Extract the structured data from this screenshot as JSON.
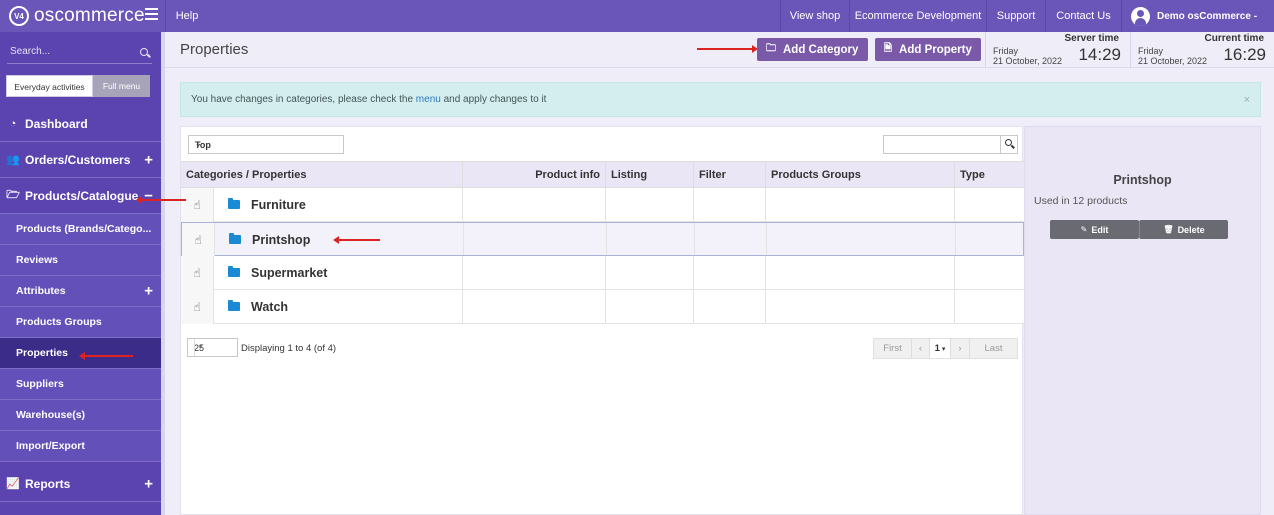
{
  "app": {
    "logo_text": "oscommerce",
    "logo_mark": "V4"
  },
  "topbar": {
    "help": "Help",
    "view_shop": "View shop",
    "ecommerce_dev": "Ecommerce Development",
    "support": "Support",
    "contact_us": "Contact Us",
    "user": "Demo osCommerce -"
  },
  "sidebar": {
    "search_placeholder": "Search...",
    "mode_everyday": "Everyday activities",
    "mode_full": "Full menu",
    "items": [
      {
        "label": "Dashboard",
        "icon": "dashboard-icon"
      },
      {
        "label": "Orders/Customers",
        "icon": "users-icon",
        "expand": "+"
      },
      {
        "label": "Products/Catalogue",
        "icon": "folder-open-icon",
        "expand": "−"
      },
      {
        "label": "Products (Brands/Catego..."
      },
      {
        "label": "Reviews"
      },
      {
        "label": "Attributes",
        "expand": "+"
      },
      {
        "label": "Products Groups"
      },
      {
        "label": "Properties"
      },
      {
        "label": "Suppliers"
      },
      {
        "label": "Warehouse(s)"
      },
      {
        "label": "Import/Export"
      },
      {
        "label": "Reports",
        "icon": "chart-icon",
        "expand": "+"
      }
    ]
  },
  "header": {
    "title": "Properties",
    "add_category": "Add Category",
    "add_property": "Add Property",
    "server_time": {
      "label": "Server time",
      "day": "Friday",
      "date": "21 October, 2022",
      "time": "14:29"
    },
    "current_time": {
      "label": "Current time",
      "day": "Friday",
      "date": "21 October, 2022",
      "time": "16:29"
    }
  },
  "alert": {
    "text_before": "You have changes in categories, please check the ",
    "link": "menu",
    "text_after": " and apply changes to it",
    "close": "×"
  },
  "filter": {
    "selected": "Top"
  },
  "table": {
    "columns": [
      "Categories / Properties",
      "Product info",
      "Listing",
      "Filter",
      "Products Groups",
      "Type"
    ],
    "rows": [
      {
        "name": "Furniture"
      },
      {
        "name": "Printshop"
      },
      {
        "name": "Supermarket"
      },
      {
        "name": "Watch"
      }
    ]
  },
  "pagination": {
    "per_page": "25",
    "displaying": "Displaying 1 to 4 (of 4)",
    "first": "First",
    "current_page": "1",
    "last": "Last"
  },
  "info_panel": {
    "title": "Printshop",
    "used_in": "Used in 12 products",
    "edit": "Edit",
    "delete": "Delete"
  },
  "colors": {
    "brand": "#6a55b8",
    "sidebar": "#5b44b0",
    "accent_button": "#7a5aa8",
    "annotation_arrow": "#dd2222"
  }
}
